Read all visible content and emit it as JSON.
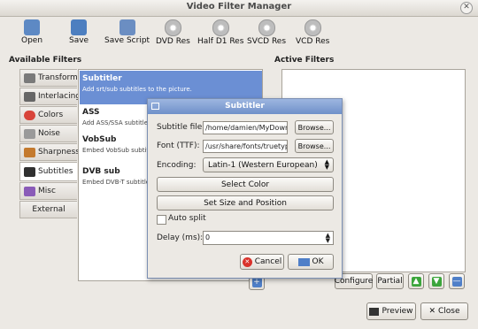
{
  "window": {
    "title": "Video Filter Manager",
    "close_glyph": "✕"
  },
  "toolbar": [
    {
      "label": "Open",
      "icon": "folder-open-icon",
      "color": "#5d89c4"
    },
    {
      "label": "Save",
      "icon": "save-icon",
      "color": "#4d7fc0"
    },
    {
      "label": "Save Script",
      "icon": "save-script-icon",
      "color": "#6b8ec2"
    },
    {
      "label": "DVD Res",
      "icon": "disc-icon"
    },
    {
      "label": "Half D1 Res",
      "icon": "disc-icon"
    },
    {
      "label": "SVCD Res",
      "icon": "disc-icon"
    },
    {
      "label": "VCD Res",
      "icon": "disc-icon"
    }
  ],
  "available_filters_label": "Available Filters",
  "active_filters_label": "Active Filters",
  "categories": [
    {
      "label": "Transform",
      "icon": "transform-icon",
      "color": "#7a7a7a"
    },
    {
      "label": "Interlacing",
      "icon": "interlacing-icon",
      "color": "#666666"
    },
    {
      "label": "Colors",
      "icon": "colors-icon",
      "color": "#d8443a"
    },
    {
      "label": "Noise",
      "icon": "noise-icon",
      "color": "#9a9a9a"
    },
    {
      "label": "Sharpness",
      "icon": "sharpness-icon",
      "color": "#c47a2e"
    },
    {
      "label": "Subtitles",
      "icon": "subtitles-icon",
      "color": "#303030",
      "selected": true
    },
    {
      "label": "Misc",
      "icon": "misc-icon",
      "color": "#8a5bb8"
    },
    {
      "label": "External",
      "icon": "",
      "color": ""
    }
  ],
  "filters": [
    {
      "name": "Subtitler",
      "desc": "Add srt/sub subtitles to the picture.",
      "selected": true
    },
    {
      "name": "ASS",
      "desc": "Add ASS/SSA subtitles"
    },
    {
      "name": "VobSub",
      "desc": "Embed VobSub subtitles"
    },
    {
      "name": "DVB sub",
      "desc": "Embed DVB-T subtitle"
    }
  ],
  "actions": {
    "configure": "Configure",
    "partial": "Partial",
    "preview": "Preview",
    "close": "Close",
    "add_glyph": "+",
    "up_glyph": "▲",
    "down_glyph": "▼",
    "remove_glyph": "—"
  },
  "dialog": {
    "title": "Subtitler",
    "subtitle_file_label": "Subtitle file:",
    "subtitle_file_value": "/home/damien/MyDown",
    "font_label": "Font (TTF):",
    "font_value": "/usr/share/fonts/truetyp",
    "browse": "Browse...",
    "encoding_label": "Encoding:",
    "encoding_value": "Latin-1 (Western European)",
    "select_color": "Select Color",
    "set_size_position": "Set Size and Position",
    "auto_split": "Auto split",
    "auto_split_checked": false,
    "delay_label": "Delay (ms):",
    "delay_value": "0",
    "cancel": "Cancel",
    "ok": "OK"
  }
}
